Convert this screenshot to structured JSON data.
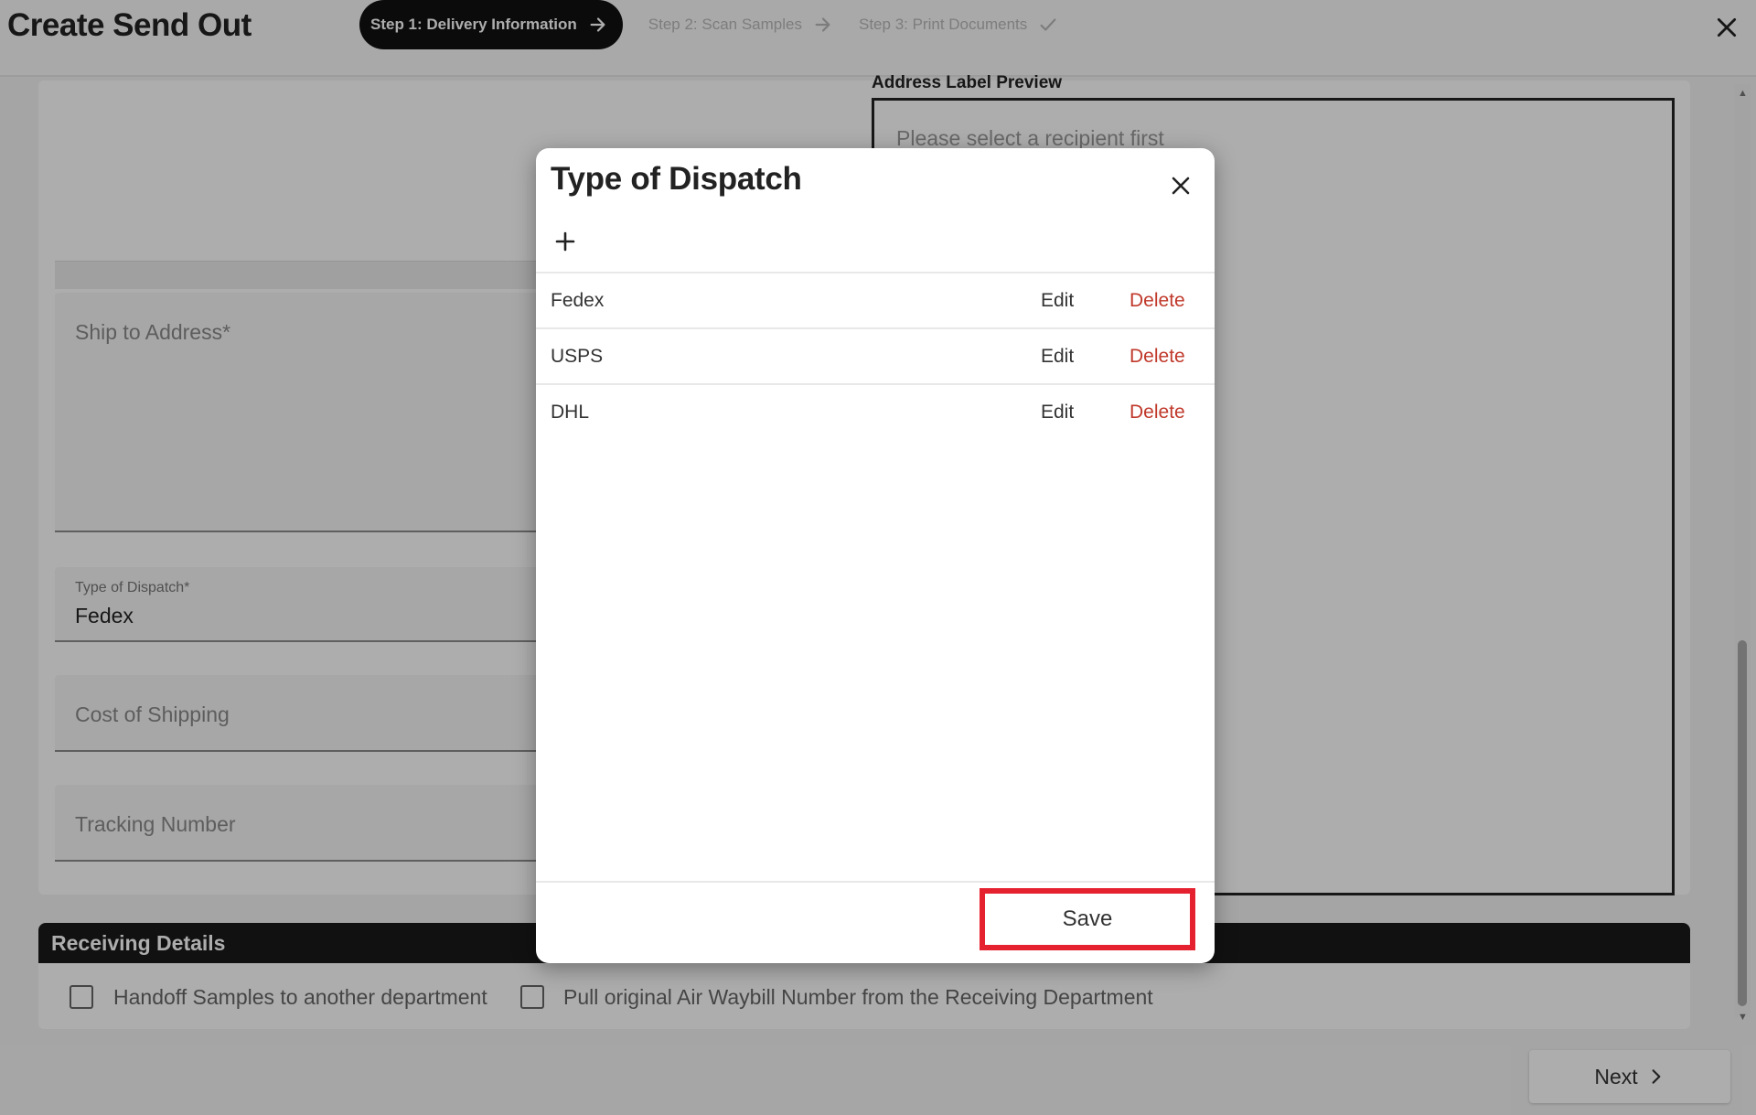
{
  "header": {
    "title": "Create Send Out",
    "steps": [
      {
        "label": "Step 1: Delivery Information",
        "icon": "arrow-right-icon",
        "active": true
      },
      {
        "label": "Step 2: Scan Samples",
        "icon": "arrow-right-icon",
        "active": false
      },
      {
        "label": "Step 3: Print Documents",
        "icon": "check-icon",
        "active": false
      }
    ]
  },
  "form": {
    "ship_to_address_placeholder": "Ship to Address*",
    "type_of_dispatch_label": "Type of Dispatch*",
    "type_of_dispatch_value": "Fedex",
    "cost_of_shipping_placeholder": "Cost of Shipping",
    "tracking_number_placeholder": "Tracking Number"
  },
  "address_preview": {
    "label": "Address Label Preview",
    "placeholder": "Please select a recipient first"
  },
  "receiving": {
    "title": "Receiving Details",
    "options": [
      {
        "label": "Handoff Samples to another department",
        "checked": false
      },
      {
        "label": "Pull original Air Waybill Number from the Receiving Department",
        "checked": false
      }
    ]
  },
  "footer": {
    "next_label": "Next"
  },
  "dialog": {
    "title": "Type of Dispatch",
    "items": [
      {
        "name": "Fedex",
        "edit": "Edit",
        "delete": "Delete"
      },
      {
        "name": "USPS",
        "edit": "Edit",
        "delete": "Delete"
      },
      {
        "name": "DHL",
        "edit": "Edit",
        "delete": "Delete"
      }
    ],
    "save_label": "Save"
  },
  "colors": {
    "delete": "#c0392b",
    "highlight": "#e5212f",
    "active_step": "#111111"
  }
}
